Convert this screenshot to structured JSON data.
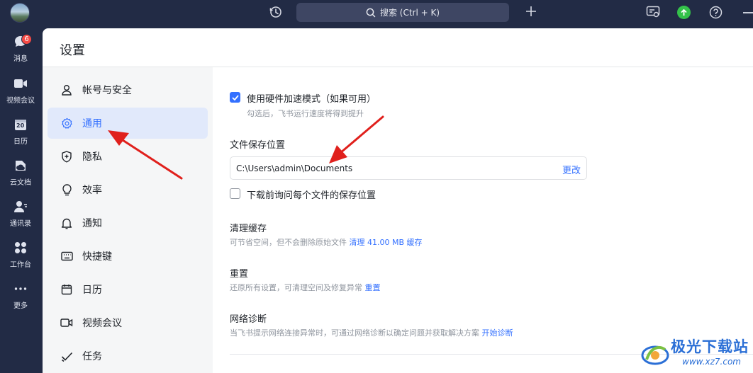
{
  "topbar": {
    "search_text": "搜索 (Ctrl + K)"
  },
  "rail": {
    "items": [
      {
        "label": "消息",
        "badge": "6"
      },
      {
        "label": "视频会议"
      },
      {
        "label": "日历",
        "day": "20"
      },
      {
        "label": "云文档"
      },
      {
        "label": "通讯录"
      },
      {
        "label": "工作台"
      },
      {
        "label": "更多"
      }
    ]
  },
  "settings": {
    "title": "设置",
    "menu": [
      {
        "label": "帐号与安全",
        "icon": "user-icon"
      },
      {
        "label": "通用",
        "icon": "gear-icon",
        "active": true
      },
      {
        "label": "隐私",
        "icon": "shield-plus-icon"
      },
      {
        "label": "效率",
        "icon": "bulb-icon"
      },
      {
        "label": "通知",
        "icon": "bell-icon"
      },
      {
        "label": "快捷键",
        "icon": "keyboard-icon"
      },
      {
        "label": "日历",
        "icon": "calendar-icon"
      },
      {
        "label": "视频会议",
        "icon": "video-icon"
      },
      {
        "label": "任务",
        "icon": "task-check-icon"
      }
    ]
  },
  "general": {
    "hw_accel": {
      "label": "使用硬件加速模式（如果可用）",
      "desc": "勾选后，飞书运行速度将得到提升",
      "checked": true
    },
    "file_location": {
      "title": "文件保存位置",
      "path": "C:\\Users\\admin\\Documents",
      "change": "更改"
    },
    "ask_each": {
      "label": "下载前询问每个文件的保存位置",
      "checked": false
    },
    "cache": {
      "title": "清理缓存",
      "desc": "可节省空间，但不会删除原始文件",
      "action": "清理 41.00 MB 缓存"
    },
    "reset": {
      "title": "重置",
      "desc": "还原所有设置，可清理空间及修复异常",
      "action": "重置"
    },
    "network": {
      "title": "网络诊断",
      "desc": "当飞书提示网络连接异常时，可通过网络诊断以确定问题并获取解决方案",
      "action": "开始诊断"
    }
  },
  "watermark": {
    "name": "极光下载站",
    "url": "www.xz7.com"
  },
  "colors": {
    "accent": "#3370ff",
    "rail_bg": "#222b45",
    "annotation": "#e0201c",
    "update_green": "#34c24a"
  }
}
